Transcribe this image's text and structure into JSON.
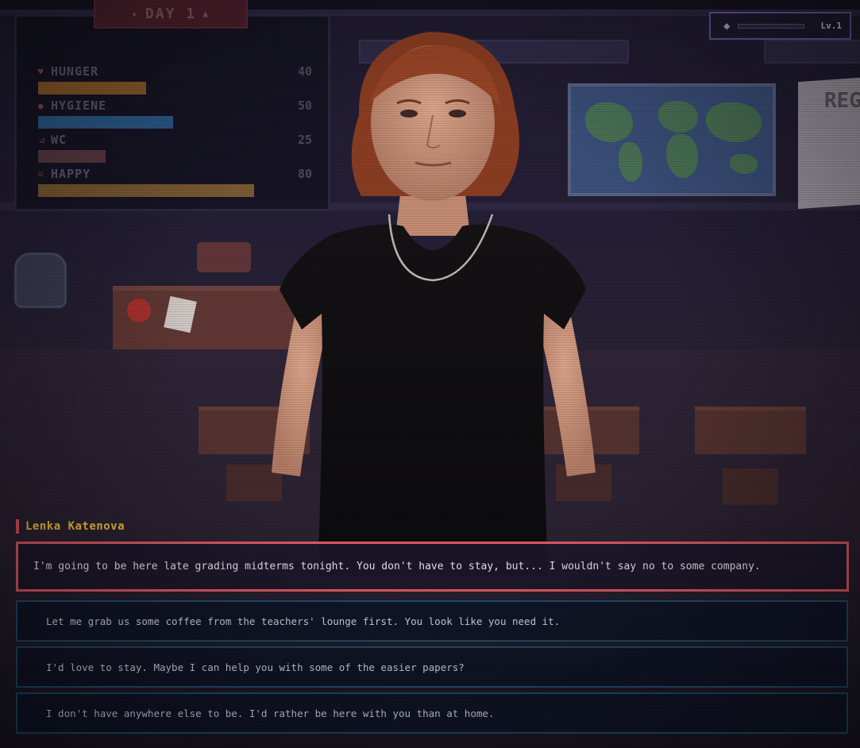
{
  "hud": {
    "day_label": "DAY 1",
    "stats": [
      {
        "label": "HUNGER",
        "value": "40",
        "level": 40,
        "color": "#8a5a2a",
        "icon": "heart-icon"
      },
      {
        "label": "HYGIENE",
        "value": "50",
        "level": 50,
        "color": "#2c5a8a",
        "icon": "soap-icon"
      },
      {
        "label": "WC",
        "value": "25",
        "level": 25,
        "color": "#5a3a42",
        "icon": "toilet-icon"
      },
      {
        "label": "HAPPY",
        "value": "80",
        "level": 80,
        "color": "#7a5a32",
        "icon": "smile-icon"
      }
    ],
    "level": {
      "label": "Lv.1",
      "xp_progress": 0,
      "icon": "graduation-cap-icon"
    }
  },
  "character": {
    "name": "Lenka Katenova"
  },
  "dialogue": {
    "speaker": "Lenka Katenova",
    "text": "I'm going to be here late grading midterms tonight. You don't have to stay, but... I wouldn't say no to some company."
  },
  "choices": [
    {
      "text": "Let me grab us some coffee from the teachers' lounge first. You look like you need it."
    },
    {
      "text": "I'd love to stay. Maybe I can help you with some of the easier papers?"
    },
    {
      "text": "I don't have anywhere else to be. I'd rather be here with you than at home."
    }
  ],
  "background": {
    "poster_text": "REG"
  },
  "colors": {
    "accent": "#e15a64",
    "speaker": "#f2c23a",
    "choice_border": "#1f4f6f",
    "level_border": "#6a4f9a"
  }
}
